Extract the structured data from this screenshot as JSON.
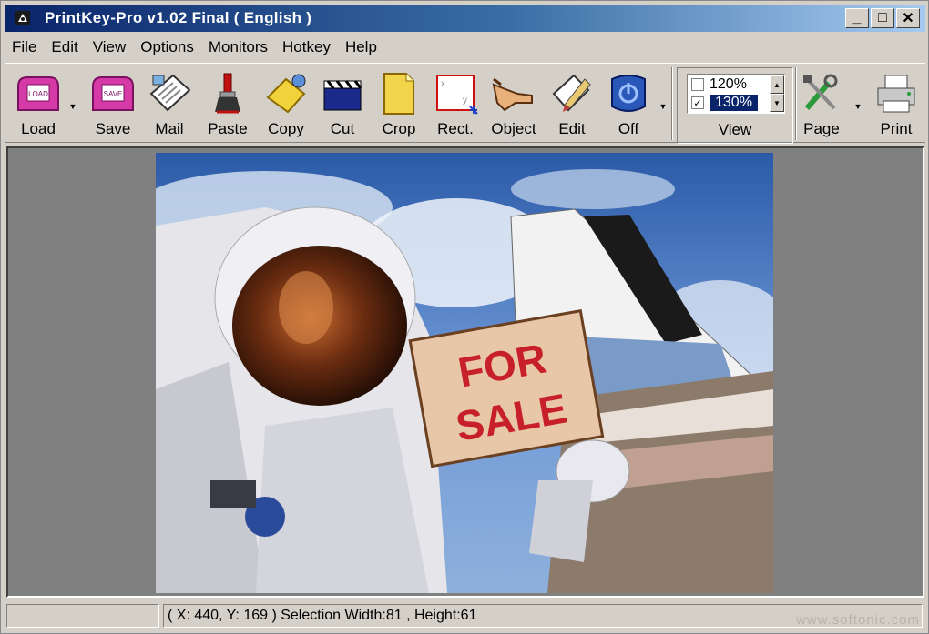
{
  "window": {
    "title": "PrintKey-Pro   v1.02 Final ( English )",
    "controls": {
      "minimize": "_",
      "maximize": "□",
      "close": "✕"
    }
  },
  "menu": [
    "File",
    "Edit",
    "View",
    "Options",
    "Monitors",
    "Hotkey",
    "Help"
  ],
  "toolbar": {
    "load": "Load",
    "save": "Save",
    "mail": "Mail",
    "paste": "Paste",
    "copy": "Copy",
    "cut": "Cut",
    "crop": "Crop",
    "rect": "Rect.",
    "object": "Object",
    "edit": "Edit",
    "off": "Off",
    "view": "View",
    "page": "Page",
    "print": "Print",
    "load_icon_text": "LOAD",
    "save_icon_text": "SAVE"
  },
  "zoom": {
    "options": [
      "120%",
      "130%"
    ],
    "selected": "130%"
  },
  "photo": {
    "sign_line1": "FOR",
    "sign_line2": "SALE"
  },
  "status": {
    "left": "",
    "info": "( X: 440, Y: 169 ) Selection Width:81 , Height:61",
    "watermark": "www.softonic.com"
  },
  "colors": {
    "titlebar_start": "#0a246a",
    "titlebar_end": "#a6caf0",
    "chrome": "#d4d0c8",
    "workarea": "#808080",
    "selection": "#0a246a"
  }
}
